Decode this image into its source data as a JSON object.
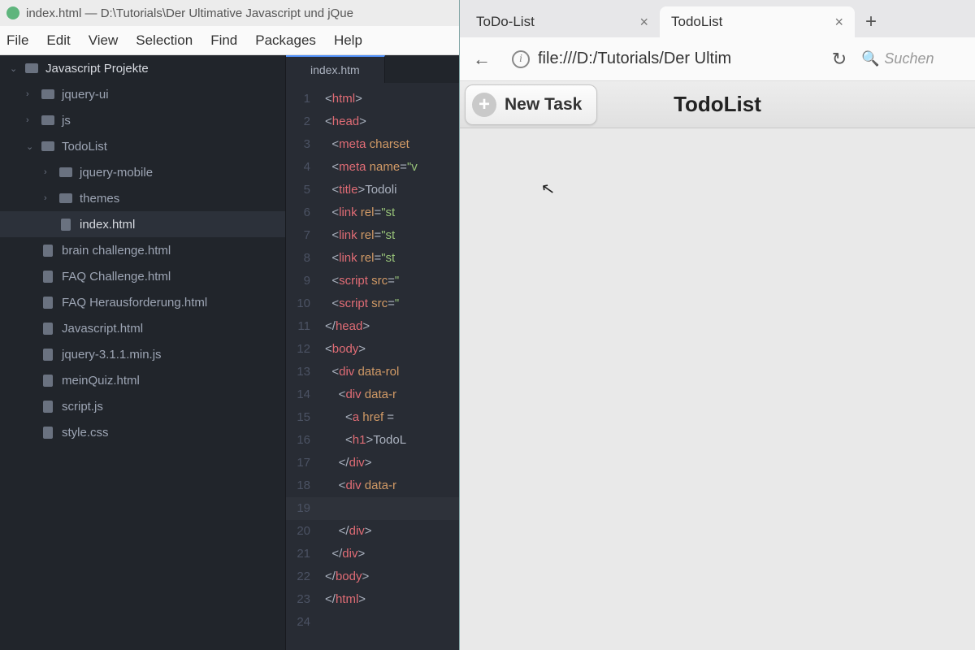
{
  "editor": {
    "titlebar": "index.html — D:\\Tutorials\\Der Ultimative Javascript und jQue",
    "menus": [
      "File",
      "Edit",
      "View",
      "Selection",
      "Find",
      "Packages",
      "Help"
    ],
    "open_tab": "index.htm",
    "tree": {
      "root": "Javascript Projekte",
      "items": [
        {
          "type": "folder",
          "name": "jquery-ui",
          "depth": 1,
          "chev": "›"
        },
        {
          "type": "folder",
          "name": "js",
          "depth": 1,
          "chev": "›"
        },
        {
          "type": "folder",
          "name": "TodoList",
          "depth": 1,
          "chev": "⌄",
          "open": true
        },
        {
          "type": "folder",
          "name": "jquery-mobile",
          "depth": 2,
          "chev": "›"
        },
        {
          "type": "folder",
          "name": "themes",
          "depth": 2,
          "chev": "›"
        },
        {
          "type": "file",
          "name": "index.html",
          "depth": 2,
          "selected": true
        },
        {
          "type": "file",
          "name": "brain challenge.html",
          "depth": 1
        },
        {
          "type": "file",
          "name": "FAQ Challenge.html",
          "depth": 1
        },
        {
          "type": "file",
          "name": "FAQ Herausforderung.html",
          "depth": 1
        },
        {
          "type": "file",
          "name": "Javascript.html",
          "depth": 1
        },
        {
          "type": "file",
          "name": "jquery-3.1.1.min.js",
          "depth": 1
        },
        {
          "type": "file",
          "name": "meinQuiz.html",
          "depth": 1
        },
        {
          "type": "file",
          "name": "script.js",
          "depth": 1
        },
        {
          "type": "file",
          "name": "style.css",
          "depth": 1
        }
      ]
    },
    "code": [
      {
        "n": 1,
        "frags": [
          [
            "p",
            "<"
          ],
          [
            "t",
            "html"
          ],
          [
            "p",
            ">"
          ]
        ]
      },
      {
        "n": 2,
        "frags": [
          [
            "p",
            "<"
          ],
          [
            "t",
            "head"
          ],
          [
            "p",
            ">"
          ]
        ]
      },
      {
        "n": 3,
        "frags": [
          [
            "p",
            "  <"
          ],
          [
            "t",
            "meta"
          ],
          [
            "p",
            " "
          ],
          [
            "a",
            "charset"
          ]
        ]
      },
      {
        "n": 4,
        "frags": [
          [
            "p",
            "  <"
          ],
          [
            "t",
            "meta"
          ],
          [
            "p",
            " "
          ],
          [
            "a",
            "name"
          ],
          [
            "p",
            "="
          ],
          [
            "s",
            "\"v"
          ]
        ]
      },
      {
        "n": 5,
        "frags": [
          [
            "p",
            "  <"
          ],
          [
            "t",
            "title"
          ],
          [
            "p",
            ">"
          ],
          [
            "tx",
            "Todoli"
          ]
        ]
      },
      {
        "n": 6,
        "frags": [
          [
            "p",
            "  <"
          ],
          [
            "t",
            "link"
          ],
          [
            "p",
            " "
          ],
          [
            "a",
            "rel"
          ],
          [
            "p",
            "="
          ],
          [
            "s",
            "\"st"
          ]
        ]
      },
      {
        "n": 7,
        "frags": [
          [
            "p",
            "  <"
          ],
          [
            "t",
            "link"
          ],
          [
            "p",
            " "
          ],
          [
            "a",
            "rel"
          ],
          [
            "p",
            "="
          ],
          [
            "s",
            "\"st"
          ]
        ]
      },
      {
        "n": 8,
        "frags": [
          [
            "p",
            "  <"
          ],
          [
            "t",
            "link"
          ],
          [
            "p",
            " "
          ],
          [
            "a",
            "rel"
          ],
          [
            "p",
            "="
          ],
          [
            "s",
            "\"st"
          ]
        ]
      },
      {
        "n": 9,
        "frags": [
          [
            "p",
            "  <"
          ],
          [
            "t",
            "script"
          ],
          [
            "p",
            " "
          ],
          [
            "a",
            "src"
          ],
          [
            "p",
            "="
          ],
          [
            "s",
            "\""
          ]
        ]
      },
      {
        "n": 10,
        "frags": [
          [
            "p",
            "  <"
          ],
          [
            "t",
            "script"
          ],
          [
            "p",
            " "
          ],
          [
            "a",
            "src"
          ],
          [
            "p",
            "="
          ],
          [
            "s",
            "\""
          ]
        ]
      },
      {
        "n": 11,
        "frags": [
          [
            "p",
            "</"
          ],
          [
            "t",
            "head"
          ],
          [
            "p",
            ">"
          ]
        ]
      },
      {
        "n": 12,
        "frags": [
          [
            "p",
            "<"
          ],
          [
            "t",
            "body"
          ],
          [
            "p",
            ">"
          ]
        ]
      },
      {
        "n": 13,
        "frags": [
          [
            "p",
            "  <"
          ],
          [
            "t",
            "div"
          ],
          [
            "p",
            " "
          ],
          [
            "a",
            "data-rol"
          ]
        ]
      },
      {
        "n": 14,
        "frags": [
          [
            "p",
            "    <"
          ],
          [
            "t",
            "div"
          ],
          [
            "p",
            " "
          ],
          [
            "a",
            "data-r"
          ]
        ]
      },
      {
        "n": 15,
        "frags": [
          [
            "p",
            "      <"
          ],
          [
            "t",
            "a"
          ],
          [
            "p",
            " "
          ],
          [
            "a",
            "href"
          ],
          [
            "p",
            " ="
          ]
        ]
      },
      {
        "n": 16,
        "frags": [
          [
            "p",
            "      <"
          ],
          [
            "t",
            "h1"
          ],
          [
            "p",
            ">"
          ],
          [
            "tx",
            "TodoL"
          ]
        ]
      },
      {
        "n": 17,
        "frags": [
          [
            "p",
            "    </"
          ],
          [
            "t",
            "div"
          ],
          [
            "p",
            ">"
          ]
        ]
      },
      {
        "n": 18,
        "frags": [
          [
            "p",
            "    <"
          ],
          [
            "t",
            "div"
          ],
          [
            "p",
            " "
          ],
          [
            "a",
            "data-r"
          ]
        ]
      },
      {
        "n": 19,
        "frags": [],
        "cursor": true
      },
      {
        "n": 20,
        "frags": [
          [
            "p",
            "    </"
          ],
          [
            "t",
            "div"
          ],
          [
            "p",
            ">"
          ]
        ]
      },
      {
        "n": 21,
        "frags": [
          [
            "p",
            "  </"
          ],
          [
            "t",
            "div"
          ],
          [
            "p",
            ">"
          ]
        ]
      },
      {
        "n": 22,
        "frags": [
          [
            "p",
            "</"
          ],
          [
            "t",
            "body"
          ],
          [
            "p",
            ">"
          ]
        ]
      },
      {
        "n": 23,
        "frags": [
          [
            "p",
            "</"
          ],
          [
            "t",
            "html"
          ],
          [
            "p",
            ">"
          ]
        ]
      },
      {
        "n": 24,
        "frags": []
      }
    ]
  },
  "browser": {
    "tabs": [
      {
        "label": "ToDo-List",
        "active": false
      },
      {
        "label": "TodoList",
        "active": true
      }
    ],
    "url": "file:///D:/Tutorials/Der Ultim",
    "search_placeholder": "Suchen",
    "page": {
      "new_task_label": "New Task",
      "title": "TodoList"
    }
  }
}
